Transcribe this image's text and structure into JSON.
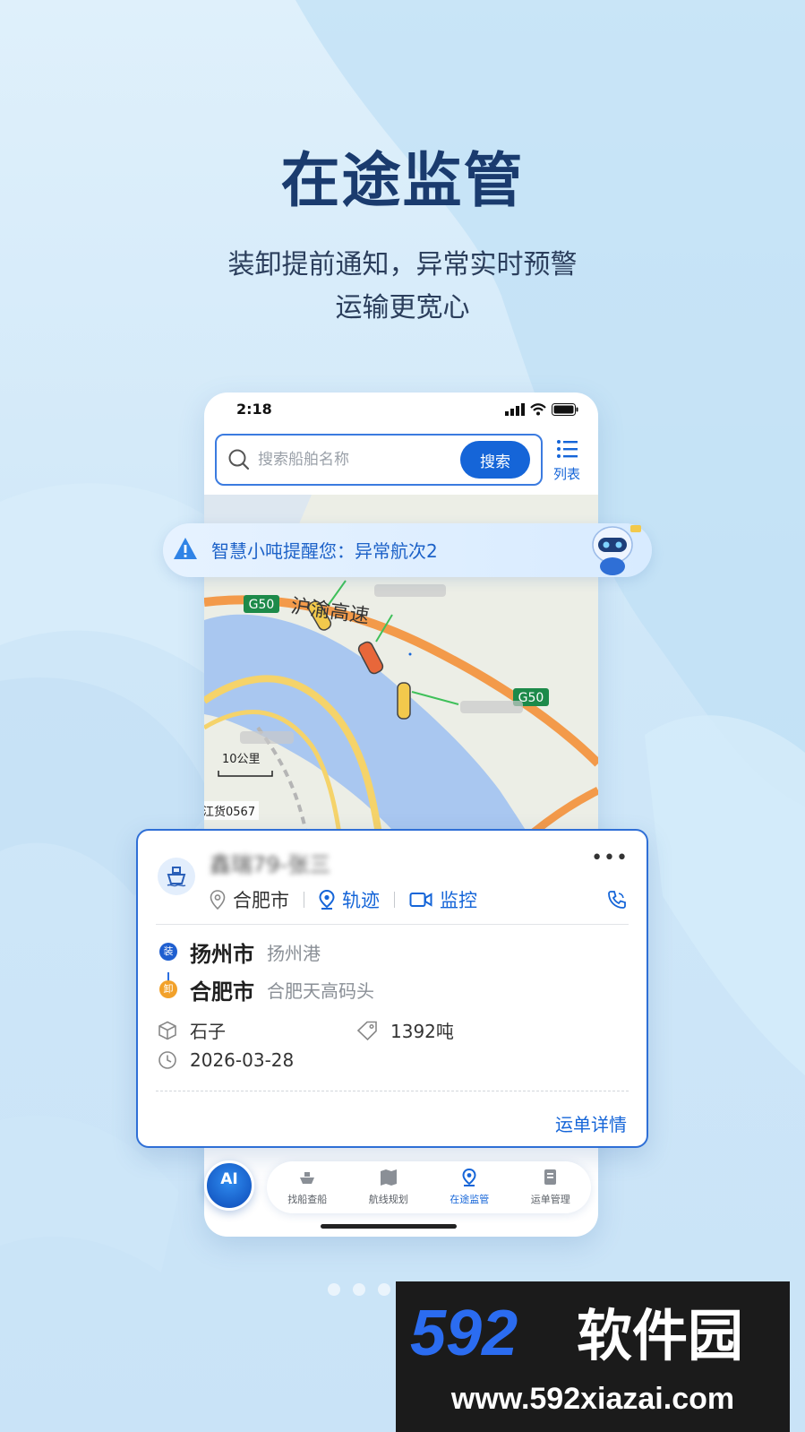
{
  "hero": {
    "title": "在途监管",
    "subtitle_line1": "装卸提前通知，异常实时预警",
    "subtitle_line2": "运输更宽心"
  },
  "status_bar": {
    "time": "2:18"
  },
  "search": {
    "placeholder": "搜索船舶名称",
    "button_label": "搜索",
    "list_label": "列表"
  },
  "map": {
    "road_labels": [
      "G50",
      "沪渝高速",
      "G50"
    ],
    "scale_label": "10公里",
    "ship_tag": "江货0567"
  },
  "alert": {
    "text": "智慧小吨提醒您：异常航次2"
  },
  "ship_card": {
    "ship_name": "鑫瑞79-张三",
    "location": "合肥市",
    "track_label": "轨迹",
    "monitor_label": "监控",
    "load": {
      "badge": "装",
      "city": "扬州市",
      "port": "扬州港"
    },
    "unload": {
      "badge": "卸",
      "city": "合肥市",
      "port": "合肥天高码头"
    },
    "cargo": "石子",
    "weight": "1392吨",
    "date": "2026-03-28",
    "detail_link": "运单详情"
  },
  "bottom_nav": {
    "ai_label": "AI",
    "items": [
      {
        "label": "找船查船",
        "icon": "ship-search-icon"
      },
      {
        "label": "航线规划",
        "icon": "route-map-icon"
      },
      {
        "label": "在途监管",
        "icon": "location-pin-icon",
        "active": true
      },
      {
        "label": "运单管理",
        "icon": "waybill-icon"
      }
    ]
  },
  "watermark": {
    "logo_text": "592软件园",
    "url": "www.592xiazai.com"
  },
  "colors": {
    "primary": "#1565d8",
    "title": "#1a3b6e",
    "load_badge": "#1f5fd0",
    "unload_badge": "#f2a12a"
  }
}
